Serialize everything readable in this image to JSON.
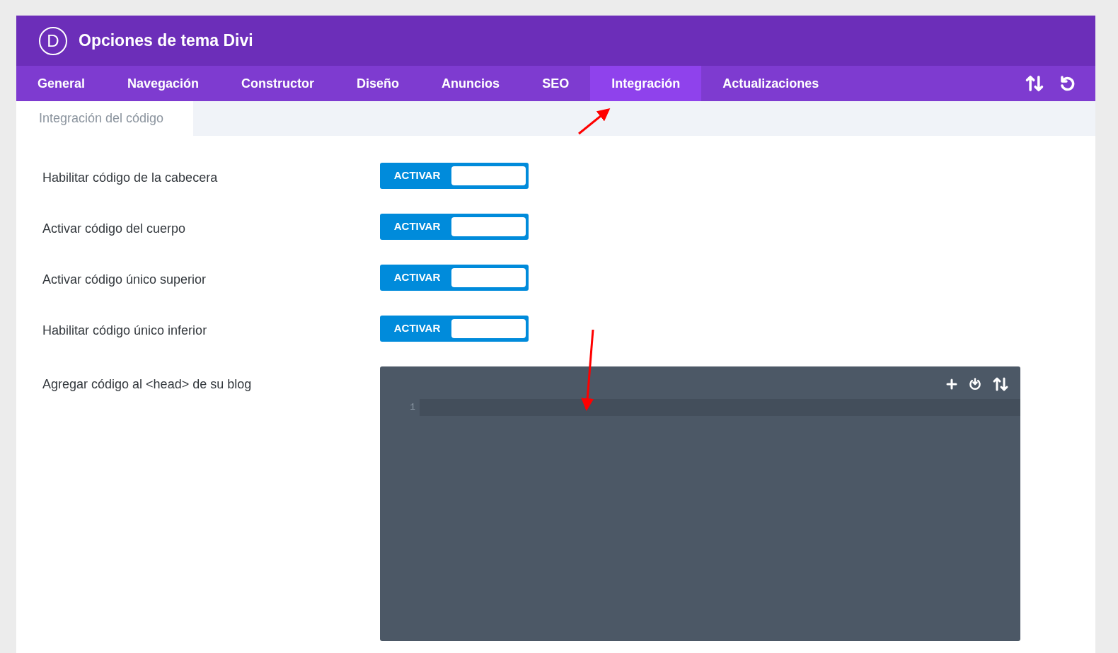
{
  "header": {
    "logo_letter": "D",
    "title": "Opciones de tema Divi"
  },
  "tabs": [
    {
      "label": "General",
      "selected": false
    },
    {
      "label": "Navegación",
      "selected": false
    },
    {
      "label": "Constructor",
      "selected": false
    },
    {
      "label": "Diseño",
      "selected": false
    },
    {
      "label": "Anuncios",
      "selected": false
    },
    {
      "label": "SEO",
      "selected": false
    },
    {
      "label": "Integración",
      "selected": true
    },
    {
      "label": "Actualizaciones",
      "selected": false
    }
  ],
  "subtabs": [
    {
      "label": "Integración del código",
      "selected": true
    }
  ],
  "settings": [
    {
      "label": "Habilitar código de la cabecera",
      "toggle_text": "ACTIVAR",
      "on": true
    },
    {
      "label": "Activar código del cuerpo",
      "toggle_text": "ACTIVAR",
      "on": true
    },
    {
      "label": "Activar código único superior",
      "toggle_text": "ACTIVAR",
      "on": true
    },
    {
      "label": "Habilitar código único inferior",
      "toggle_text": "ACTIVAR",
      "on": true
    }
  ],
  "code_field": {
    "label": "Agregar código al <head> de su blog",
    "line_numbers": [
      "1"
    ]
  }
}
